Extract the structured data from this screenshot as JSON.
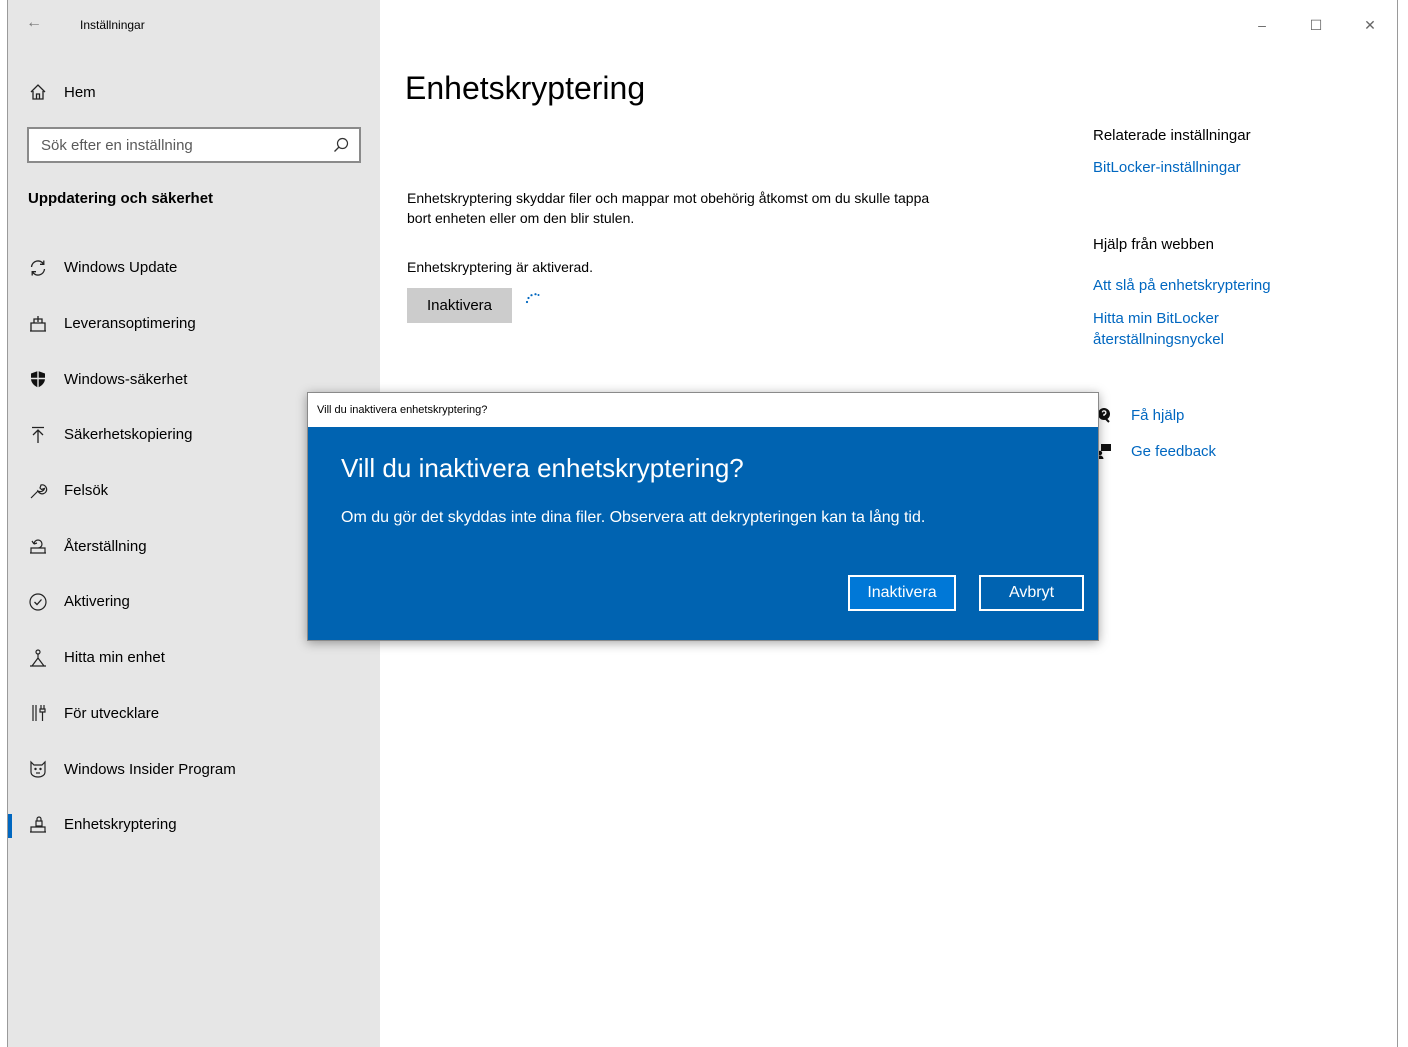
{
  "window": {
    "title": "Inställningar",
    "controls": {
      "minimize": "–",
      "maximize": "☐",
      "close": "✕"
    }
  },
  "sidebar": {
    "home_label": "Hem",
    "search_placeholder": "Sök efter en inställning",
    "section_title": "Uppdatering och säkerhet",
    "items": [
      {
        "label": "Windows Update",
        "icon": "sync-icon"
      },
      {
        "label": "Leveransoptimering",
        "icon": "delivery-optimization-icon"
      },
      {
        "label": "Windows-säkerhet",
        "icon": "shield-icon"
      },
      {
        "label": "Säkerhetskopiering",
        "icon": "backup-arrow-icon"
      },
      {
        "label": "Felsök",
        "icon": "wrench-icon"
      },
      {
        "label": "Återställning",
        "icon": "recovery-icon"
      },
      {
        "label": "Aktivering",
        "icon": "check-circle-icon"
      },
      {
        "label": "Hitta min enhet",
        "icon": "find-device-icon"
      },
      {
        "label": "För utvecklare",
        "icon": "developer-tools-icon"
      },
      {
        "label": "Windows Insider Program",
        "icon": "insider-cat-icon"
      },
      {
        "label": "Enhetskryptering",
        "icon": "drive-lock-icon",
        "active": true
      }
    ]
  },
  "main": {
    "title": "Enhetskryptering",
    "description": "Enhetskryptering skyddar filer och mappar mot obehörig åtkomst om du skulle tappa bort enheten eller om den blir stulen.",
    "status": "Enhetskryptering är aktiverad.",
    "deactivate_button": "Inaktivera"
  },
  "related": {
    "heading": "Relaterade inställningar",
    "bitlocker_link": "BitLocker-inställningar",
    "help_heading": "Hjälp från webben",
    "help_link_1": "Att slå på enhetskryptering",
    "help_link_2": "Hitta min BitLocker återställningsnyckel",
    "get_help": "Få hjälp",
    "feedback": "Ge feedback"
  },
  "dialog": {
    "window_title": "Vill du inaktivera enhetskryptering?",
    "heading": "Vill du inaktivera enhetskryptering?",
    "message": "Om du gör det skyddas inte dina filer. Observera att dekrypteringen kan ta lång tid.",
    "confirm_button": "Inaktivera",
    "cancel_button": "Avbryt",
    "background_color": "#0063b1"
  },
  "colors": {
    "accent": "#0067c0",
    "sidebar_bg": "#e6e6e6"
  }
}
